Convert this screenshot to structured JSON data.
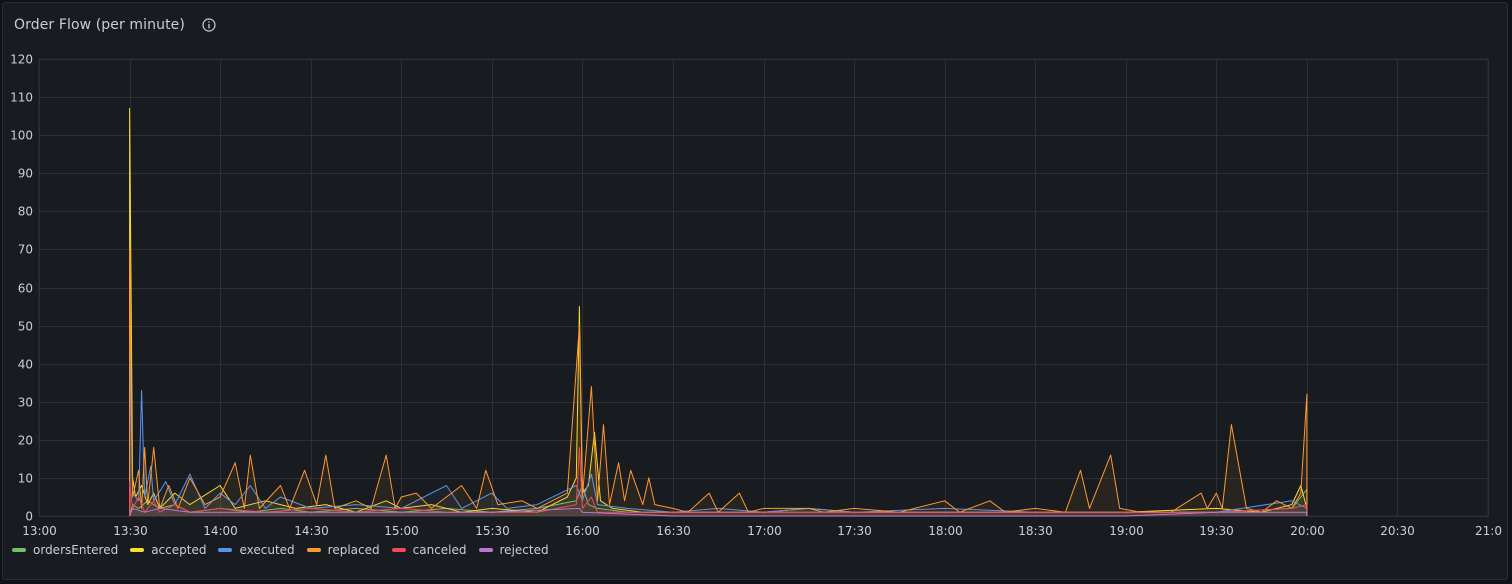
{
  "panel": {
    "title": "Order Flow (per minute)",
    "info_icon": "info-circle-icon"
  },
  "colors": {
    "background": "#181b1f",
    "grid": "#2c2f36",
    "text": "#ccccdc"
  },
  "chart_data": {
    "type": "line",
    "title": "Order Flow (per minute)",
    "xlabel": "",
    "ylabel": "",
    "ylim": [
      0,
      120
    ],
    "yticks": [
      0,
      10,
      20,
      30,
      40,
      50,
      60,
      70,
      80,
      90,
      100,
      110,
      120
    ],
    "xlim": [
      "13:00",
      "21:00"
    ],
    "xticks": [
      "13:00",
      "13:30",
      "14:00",
      "14:30",
      "15:00",
      "15:30",
      "16:00",
      "16:30",
      "17:00",
      "17:30",
      "18:00",
      "18:30",
      "19:00",
      "19:30",
      "20:00",
      "20:30",
      "21:0"
    ],
    "grid": true,
    "legend_position": "bottom-left",
    "series": [
      {
        "name": "ordersEntered",
        "color": "#73bf69",
        "points": [
          [
            "13:30",
            0
          ],
          [
            "13:31",
            3
          ],
          [
            "13:33",
            2
          ],
          [
            "13:36",
            4
          ],
          [
            "13:40",
            2
          ],
          [
            "13:45",
            3
          ],
          [
            "13:50",
            1
          ],
          [
            "14:00",
            2
          ],
          [
            "14:10",
            1
          ],
          [
            "14:20",
            2
          ],
          [
            "14:30",
            1
          ],
          [
            "14:45",
            2
          ],
          [
            "15:00",
            1
          ],
          [
            "15:15",
            2
          ],
          [
            "15:30",
            1
          ],
          [
            "15:45",
            2
          ],
          [
            "15:58",
            4
          ],
          [
            "16:00",
            8
          ],
          [
            "16:02",
            3
          ],
          [
            "16:05",
            2
          ],
          [
            "16:15",
            1
          ],
          [
            "16:30",
            1
          ],
          [
            "17:00",
            1
          ],
          [
            "17:30",
            1
          ],
          [
            "18:00",
            1
          ],
          [
            "18:30",
            1
          ],
          [
            "19:00",
            1
          ],
          [
            "19:30",
            1
          ],
          [
            "19:55",
            2
          ],
          [
            "20:00",
            7
          ],
          [
            "20:00",
            0
          ]
        ]
      },
      {
        "name": "accepted",
        "color": "#fade2a",
        "points": [
          [
            "13:30",
            0
          ],
          [
            "13:30",
            107
          ],
          [
            "13:31",
            10
          ],
          [
            "13:32",
            5
          ],
          [
            "13:34",
            8
          ],
          [
            "13:36",
            3
          ],
          [
            "13:38",
            6
          ],
          [
            "13:40",
            2
          ],
          [
            "13:45",
            6
          ],
          [
            "13:50",
            3
          ],
          [
            "14:00",
            8
          ],
          [
            "14:05",
            2
          ],
          [
            "14:15",
            4
          ],
          [
            "14:25",
            2
          ],
          [
            "14:35",
            3
          ],
          [
            "14:45",
            1
          ],
          [
            "14:55",
            4
          ],
          [
            "15:00",
            2
          ],
          [
            "15:10",
            3
          ],
          [
            "15:20",
            1
          ],
          [
            "15:30",
            2
          ],
          [
            "15:45",
            1
          ],
          [
            "15:55",
            5
          ],
          [
            "15:58",
            10
          ],
          [
            "15:59",
            55
          ],
          [
            "16:00",
            6
          ],
          [
            "16:02",
            8
          ],
          [
            "16:04",
            22
          ],
          [
            "16:06",
            4
          ],
          [
            "16:10",
            2
          ],
          [
            "16:20",
            1
          ],
          [
            "16:30",
            1
          ],
          [
            "17:00",
            1
          ],
          [
            "17:15",
            2
          ],
          [
            "17:30",
            1
          ],
          [
            "18:00",
            1
          ],
          [
            "18:30",
            1
          ],
          [
            "19:00",
            1
          ],
          [
            "19:30",
            2
          ],
          [
            "19:45",
            1
          ],
          [
            "19:55",
            3
          ],
          [
            "19:58",
            8
          ],
          [
            "20:00",
            2
          ],
          [
            "20:00",
            0
          ]
        ]
      },
      {
        "name": "executed",
        "color": "#5794f2",
        "points": [
          [
            "13:30",
            0
          ],
          [
            "13:30",
            47
          ],
          [
            "13:31",
            6
          ],
          [
            "13:33",
            4
          ],
          [
            "13:34",
            33
          ],
          [
            "13:35",
            5
          ],
          [
            "13:37",
            13
          ],
          [
            "13:38",
            4
          ],
          [
            "13:42",
            9
          ],
          [
            "13:45",
            3
          ],
          [
            "13:50",
            11
          ],
          [
            "13:55",
            2
          ],
          [
            "14:00",
            6
          ],
          [
            "14:05",
            3
          ],
          [
            "14:10",
            8
          ],
          [
            "14:15",
            2
          ],
          [
            "14:20",
            5
          ],
          [
            "14:30",
            2
          ],
          [
            "14:45",
            3
          ],
          [
            "15:00",
            2
          ],
          [
            "15:15",
            8
          ],
          [
            "15:20",
            2
          ],
          [
            "15:30",
            6
          ],
          [
            "15:35",
            2
          ],
          [
            "15:45",
            3
          ],
          [
            "15:58",
            8
          ],
          [
            "16:00",
            4
          ],
          [
            "16:03",
            11
          ],
          [
            "16:05",
            3
          ],
          [
            "16:15",
            2
          ],
          [
            "16:30",
            1
          ],
          [
            "16:45",
            2
          ],
          [
            "17:00",
            1
          ],
          [
            "17:15",
            2
          ],
          [
            "17:30",
            1
          ],
          [
            "18:00",
            2
          ],
          [
            "18:30",
            1
          ],
          [
            "19:00",
            1
          ],
          [
            "19:30",
            1
          ],
          [
            "19:55",
            4
          ],
          [
            "20:00",
            2
          ],
          [
            "20:00",
            0
          ]
        ]
      },
      {
        "name": "replaced",
        "color": "#ff9830",
        "points": [
          [
            "13:30",
            0
          ],
          [
            "13:30",
            70
          ],
          [
            "13:31",
            5
          ],
          [
            "13:33",
            12
          ],
          [
            "13:34",
            2
          ],
          [
            "13:35",
            18
          ],
          [
            "13:36",
            3
          ],
          [
            "13:38",
            18
          ],
          [
            "13:40",
            2
          ],
          [
            "13:43",
            8
          ],
          [
            "13:46",
            2
          ],
          [
            "13:50",
            10
          ],
          [
            "13:55",
            3
          ],
          [
            "14:00",
            5
          ],
          [
            "14:05",
            14
          ],
          [
            "14:08",
            2
          ],
          [
            "14:10",
            16
          ],
          [
            "14:13",
            2
          ],
          [
            "14:20",
            8
          ],
          [
            "14:23",
            2
          ],
          [
            "14:28",
            12
          ],
          [
            "14:32",
            3
          ],
          [
            "14:35",
            16
          ],
          [
            "14:38",
            2
          ],
          [
            "14:45",
            4
          ],
          [
            "14:50",
            2
          ],
          [
            "14:55",
            16
          ],
          [
            "14:58",
            2
          ],
          [
            "15:00",
            5
          ],
          [
            "15:05",
            6
          ],
          [
            "15:10",
            2
          ],
          [
            "15:20",
            8
          ],
          [
            "15:25",
            2
          ],
          [
            "15:28",
            12
          ],
          [
            "15:32",
            3
          ],
          [
            "15:40",
            4
          ],
          [
            "15:45",
            2
          ],
          [
            "15:55",
            6
          ],
          [
            "15:59",
            50
          ],
          [
            "16:00",
            5
          ],
          [
            "16:03",
            34
          ],
          [
            "16:05",
            4
          ],
          [
            "16:07",
            24
          ],
          [
            "16:09",
            3
          ],
          [
            "16:12",
            14
          ],
          [
            "16:14",
            4
          ],
          [
            "16:16",
            12
          ],
          [
            "16:20",
            3
          ],
          [
            "16:22",
            10
          ],
          [
            "16:24",
            3
          ],
          [
            "16:30",
            2
          ],
          [
            "16:35",
            1
          ],
          [
            "16:42",
            6
          ],
          [
            "16:45",
            1
          ],
          [
            "16:52",
            6
          ],
          [
            "16:55",
            1
          ],
          [
            "17:00",
            2
          ],
          [
            "17:15",
            2
          ],
          [
            "17:20",
            1
          ],
          [
            "17:30",
            2
          ],
          [
            "17:45",
            1
          ],
          [
            "18:00",
            4
          ],
          [
            "18:05",
            1
          ],
          [
            "18:15",
            4
          ],
          [
            "18:20",
            1
          ],
          [
            "18:30",
            2
          ],
          [
            "18:40",
            1
          ],
          [
            "18:45",
            12
          ],
          [
            "18:48",
            2
          ],
          [
            "18:55",
            16
          ],
          [
            "18:58",
            2
          ],
          [
            "19:05",
            1
          ],
          [
            "19:15",
            1
          ],
          [
            "19:25",
            6
          ],
          [
            "19:27",
            2
          ],
          [
            "19:30",
            6
          ],
          [
            "19:32",
            2
          ],
          [
            "19:35",
            24
          ],
          [
            "19:40",
            2
          ],
          [
            "19:45",
            1
          ],
          [
            "19:50",
            4
          ],
          [
            "19:55",
            2
          ],
          [
            "19:58",
            6
          ],
          [
            "20:00",
            32
          ],
          [
            "20:00",
            0
          ]
        ]
      },
      {
        "name": "canceled",
        "color": "#f2495c",
        "points": [
          [
            "13:30",
            0
          ],
          [
            "13:30",
            9
          ],
          [
            "13:31",
            2
          ],
          [
            "13:33",
            5
          ],
          [
            "13:35",
            1
          ],
          [
            "13:38",
            4
          ],
          [
            "13:40",
            1
          ],
          [
            "13:45",
            3
          ],
          [
            "13:50",
            1
          ],
          [
            "14:00",
            2
          ],
          [
            "14:15",
            1
          ],
          [
            "14:30",
            2
          ],
          [
            "14:45",
            1
          ],
          [
            "15:00",
            2
          ],
          [
            "15:15",
            1
          ],
          [
            "15:30",
            1
          ],
          [
            "15:45",
            1
          ],
          [
            "15:58",
            3
          ],
          [
            "15:59",
            18
          ],
          [
            "16:00",
            2
          ],
          [
            "16:03",
            5
          ],
          [
            "16:05",
            1
          ],
          [
            "16:15",
            1
          ],
          [
            "16:30",
            1
          ],
          [
            "17:00",
            1
          ],
          [
            "17:30",
            1
          ],
          [
            "18:00",
            1
          ],
          [
            "18:30",
            1
          ],
          [
            "19:00",
            1
          ],
          [
            "19:30",
            1
          ],
          [
            "19:55",
            2
          ],
          [
            "20:00",
            3
          ],
          [
            "20:00",
            0
          ]
        ]
      },
      {
        "name": "rejected",
        "color": "#b877d9",
        "points": [
          [
            "13:30",
            0
          ],
          [
            "13:31",
            2
          ],
          [
            "13:35",
            1
          ],
          [
            "13:40",
            2
          ],
          [
            "13:50",
            1
          ],
          [
            "14:00",
            1
          ],
          [
            "14:30",
            1
          ],
          [
            "15:00",
            1
          ],
          [
            "15:30",
            1
          ],
          [
            "15:59",
            2
          ],
          [
            "16:00",
            1
          ],
          [
            "16:30",
            0
          ],
          [
            "17:00",
            0
          ],
          [
            "18:00",
            0
          ],
          [
            "19:00",
            0
          ],
          [
            "19:30",
            1
          ],
          [
            "20:00",
            1
          ],
          [
            "20:00",
            0
          ]
        ]
      }
    ]
  }
}
